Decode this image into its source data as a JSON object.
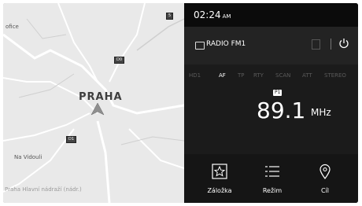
{
  "map": {
    "city_label": "PRAHA",
    "labels": {
      "top_left": "ofice",
      "bottom_left": "Na Vidouli",
      "bottom_strip": "Praha Hlavní nádraží (nádr.)"
    },
    "road_shields": [
      "D0",
      "D1",
      "5"
    ]
  },
  "status": {
    "time": "02:24",
    "ampm": "AM"
  },
  "radio": {
    "source_label": "RADIO FM1",
    "options": [
      "HD1",
      "AF",
      "TP",
      "RTY",
      "SCAN",
      "ATT",
      "STEREO"
    ],
    "active_option": "AF",
    "preset": "P1",
    "frequency": "89.1",
    "unit": "MHz"
  },
  "bottom_buttons": [
    {
      "label": "Záložka",
      "icon": "star-icon"
    },
    {
      "label": "Režim",
      "icon": "list-icon"
    },
    {
      "label": "Cíl",
      "icon": "location-pin-icon"
    }
  ]
}
